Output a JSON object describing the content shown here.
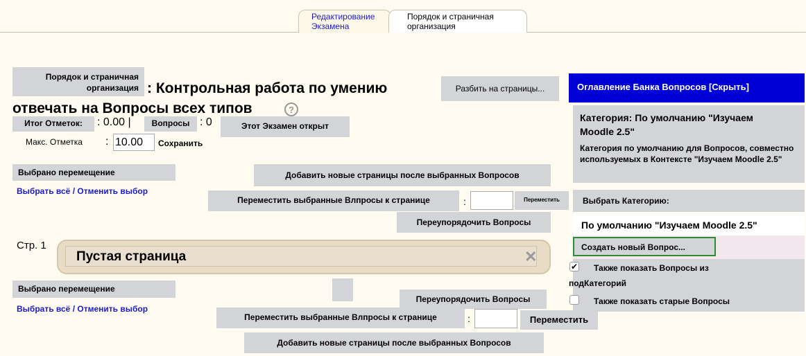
{
  "tabs": [
    {
      "label_line1": "Редактирование",
      "label_line2": "Экзамена"
    },
    {
      "label_line1": "Порядок и страничная",
      "label_line2": "организация"
    }
  ],
  "heading": {
    "label_line1": "Порядок и страничная",
    "label_line2": "организация",
    "title_line1": ": Контрольная работа по умению",
    "title_line2": "отвечать на Вопросы всех типов",
    "help_icon": "?"
  },
  "paginate_button": "Разбить на страницы...",
  "summary": {
    "grades_label": "Итог Отметок:",
    "grades_value": ": 0.00 |",
    "questions_label": "Вопросы",
    "questions_value": ": 0",
    "quiz_open": "Этот Экзамен открыт",
    "max_grade_label": "Макс. Отметка",
    "max_grade_colon": ":",
    "max_grade_value": "10.00",
    "save_button": "Сохранить"
  },
  "top_controls": {
    "selected_move": "Выбрано перемещение",
    "select_all": "Выбрать всё",
    "separator": "/",
    "deselect": "Отменить выбор",
    "add_pages": "Добавить новые страницы после выбранных Вопросов",
    "move_to_page": "Переместить выбранные Влпросы к странице",
    "colon": ":",
    "move_button": "Переместить",
    "reorder": "Переупорядочить Вопросы"
  },
  "page": {
    "label": "Стр.",
    "number": "1",
    "empty_title": "Пустая страница",
    "close_icon": "✕"
  },
  "bottom_controls": {
    "selected_move": "Выбрано перемещение",
    "select_all": "Выбрать всё",
    "separator": "/",
    "deselect": "Отменить выбор",
    "reorder": "Переупорядочить Вопросы",
    "move_to_page": "Переместить выбранные Влпросы к странице",
    "colon": ":",
    "move_button": "Переместить",
    "add_pages": "Добавить новые страницы после выбранных Вопросов"
  },
  "question_bank": {
    "header": "Оглавление Банка Вопросов [Скрыть]",
    "category_line1": "Категория: По умолчанию \"Изучаем",
    "category_line2": "Moodle 2.5\"",
    "description": "Категория по умолчанию для Вопросов, совместно используемых в Контексте \"Изучаем Moodle 2.5\"",
    "select_category_label": "Выбрать Категорию:",
    "selected_category": "По умолчанию \"Изучаем Moodle 2.5\"",
    "create_button": "Создать новый Вопрос...",
    "show_subcategories_line1": "Также показать Вопросы из",
    "show_subcategories_line2": "подКатегорий",
    "show_subcategories_checked": true,
    "show_old": "Также показать старые Вопросы",
    "show_old_checked": false,
    "check_mark": "✔"
  },
  "colors": {
    "page_bg": "#fffbf0",
    "button_gray": "#d2d4d8",
    "header_blue": "#0000d6",
    "link_blue": "#1a1ad0"
  }
}
